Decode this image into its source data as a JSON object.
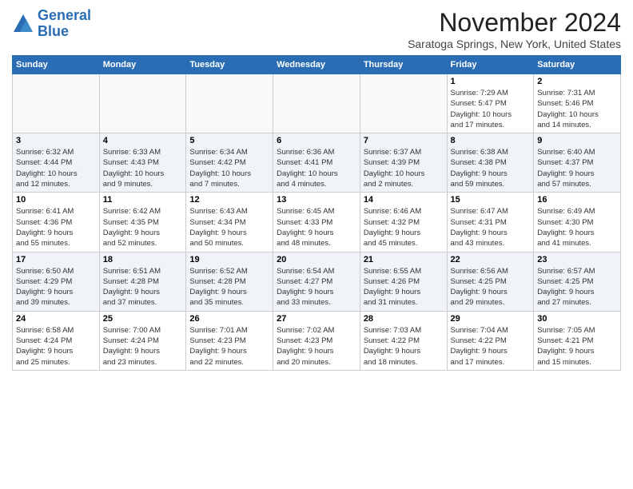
{
  "header": {
    "logo_line1": "General",
    "logo_line2": "Blue",
    "month": "November 2024",
    "location": "Saratoga Springs, New York, United States"
  },
  "weekdays": [
    "Sunday",
    "Monday",
    "Tuesday",
    "Wednesday",
    "Thursday",
    "Friday",
    "Saturday"
  ],
  "weeks": [
    [
      {
        "day": "",
        "info": "",
        "empty": true
      },
      {
        "day": "",
        "info": "",
        "empty": true
      },
      {
        "day": "",
        "info": "",
        "empty": true
      },
      {
        "day": "",
        "info": "",
        "empty": true
      },
      {
        "day": "",
        "info": "",
        "empty": true
      },
      {
        "day": "1",
        "info": "Sunrise: 7:29 AM\nSunset: 5:47 PM\nDaylight: 10 hours\nand 17 minutes.",
        "empty": false
      },
      {
        "day": "2",
        "info": "Sunrise: 7:31 AM\nSunset: 5:46 PM\nDaylight: 10 hours\nand 14 minutes.",
        "empty": false
      }
    ],
    [
      {
        "day": "3",
        "info": "Sunrise: 6:32 AM\nSunset: 4:44 PM\nDaylight: 10 hours\nand 12 minutes.",
        "empty": false
      },
      {
        "day": "4",
        "info": "Sunrise: 6:33 AM\nSunset: 4:43 PM\nDaylight: 10 hours\nand 9 minutes.",
        "empty": false
      },
      {
        "day": "5",
        "info": "Sunrise: 6:34 AM\nSunset: 4:42 PM\nDaylight: 10 hours\nand 7 minutes.",
        "empty": false
      },
      {
        "day": "6",
        "info": "Sunrise: 6:36 AM\nSunset: 4:41 PM\nDaylight: 10 hours\nand 4 minutes.",
        "empty": false
      },
      {
        "day": "7",
        "info": "Sunrise: 6:37 AM\nSunset: 4:39 PM\nDaylight: 10 hours\nand 2 minutes.",
        "empty": false
      },
      {
        "day": "8",
        "info": "Sunrise: 6:38 AM\nSunset: 4:38 PM\nDaylight: 9 hours\nand 59 minutes.",
        "empty": false
      },
      {
        "day": "9",
        "info": "Sunrise: 6:40 AM\nSunset: 4:37 PM\nDaylight: 9 hours\nand 57 minutes.",
        "empty": false
      }
    ],
    [
      {
        "day": "10",
        "info": "Sunrise: 6:41 AM\nSunset: 4:36 PM\nDaylight: 9 hours\nand 55 minutes.",
        "empty": false
      },
      {
        "day": "11",
        "info": "Sunrise: 6:42 AM\nSunset: 4:35 PM\nDaylight: 9 hours\nand 52 minutes.",
        "empty": false
      },
      {
        "day": "12",
        "info": "Sunrise: 6:43 AM\nSunset: 4:34 PM\nDaylight: 9 hours\nand 50 minutes.",
        "empty": false
      },
      {
        "day": "13",
        "info": "Sunrise: 6:45 AM\nSunset: 4:33 PM\nDaylight: 9 hours\nand 48 minutes.",
        "empty": false
      },
      {
        "day": "14",
        "info": "Sunrise: 6:46 AM\nSunset: 4:32 PM\nDaylight: 9 hours\nand 45 minutes.",
        "empty": false
      },
      {
        "day": "15",
        "info": "Sunrise: 6:47 AM\nSunset: 4:31 PM\nDaylight: 9 hours\nand 43 minutes.",
        "empty": false
      },
      {
        "day": "16",
        "info": "Sunrise: 6:49 AM\nSunset: 4:30 PM\nDaylight: 9 hours\nand 41 minutes.",
        "empty": false
      }
    ],
    [
      {
        "day": "17",
        "info": "Sunrise: 6:50 AM\nSunset: 4:29 PM\nDaylight: 9 hours\nand 39 minutes.",
        "empty": false
      },
      {
        "day": "18",
        "info": "Sunrise: 6:51 AM\nSunset: 4:28 PM\nDaylight: 9 hours\nand 37 minutes.",
        "empty": false
      },
      {
        "day": "19",
        "info": "Sunrise: 6:52 AM\nSunset: 4:28 PM\nDaylight: 9 hours\nand 35 minutes.",
        "empty": false
      },
      {
        "day": "20",
        "info": "Sunrise: 6:54 AM\nSunset: 4:27 PM\nDaylight: 9 hours\nand 33 minutes.",
        "empty": false
      },
      {
        "day": "21",
        "info": "Sunrise: 6:55 AM\nSunset: 4:26 PM\nDaylight: 9 hours\nand 31 minutes.",
        "empty": false
      },
      {
        "day": "22",
        "info": "Sunrise: 6:56 AM\nSunset: 4:25 PM\nDaylight: 9 hours\nand 29 minutes.",
        "empty": false
      },
      {
        "day": "23",
        "info": "Sunrise: 6:57 AM\nSunset: 4:25 PM\nDaylight: 9 hours\nand 27 minutes.",
        "empty": false
      }
    ],
    [
      {
        "day": "24",
        "info": "Sunrise: 6:58 AM\nSunset: 4:24 PM\nDaylight: 9 hours\nand 25 minutes.",
        "empty": false
      },
      {
        "day": "25",
        "info": "Sunrise: 7:00 AM\nSunset: 4:24 PM\nDaylight: 9 hours\nand 23 minutes.",
        "empty": false
      },
      {
        "day": "26",
        "info": "Sunrise: 7:01 AM\nSunset: 4:23 PM\nDaylight: 9 hours\nand 22 minutes.",
        "empty": false
      },
      {
        "day": "27",
        "info": "Sunrise: 7:02 AM\nSunset: 4:23 PM\nDaylight: 9 hours\nand 20 minutes.",
        "empty": false
      },
      {
        "day": "28",
        "info": "Sunrise: 7:03 AM\nSunset: 4:22 PM\nDaylight: 9 hours\nand 18 minutes.",
        "empty": false
      },
      {
        "day": "29",
        "info": "Sunrise: 7:04 AM\nSunset: 4:22 PM\nDaylight: 9 hours\nand 17 minutes.",
        "empty": false
      },
      {
        "day": "30",
        "info": "Sunrise: 7:05 AM\nSunset: 4:21 PM\nDaylight: 9 hours\nand 15 minutes.",
        "empty": false
      }
    ]
  ]
}
